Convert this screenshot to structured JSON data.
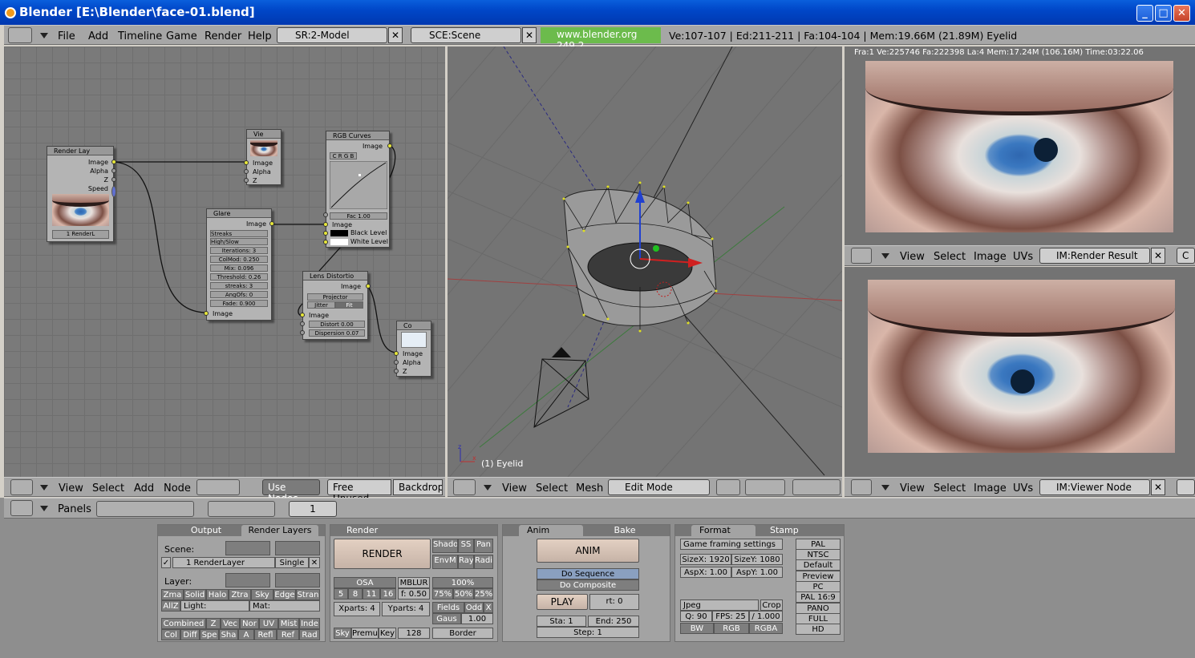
{
  "window": {
    "title": "Blender  [E:\\Blender\\face-01.blend]",
    "min": "_",
    "max": "□",
    "close": "✕"
  },
  "infobar": {
    "menus": [
      "File",
      "Add",
      "Timeline",
      "Game",
      "Render",
      "Help"
    ],
    "screen": "SR:2-Model",
    "scene": "SCE:Scene",
    "url": "www.blender.org 249.2",
    "stats": "Ve:107-107 | Ed:211-211 | Fa:104-104 | Mem:19.66M (21.89M) Eyelid"
  },
  "node_editor": {
    "menus": [
      "View",
      "Select",
      "Add",
      "Node"
    ],
    "use_nodes": "Use Nodes",
    "free_unused": "Free Unused",
    "backdrop": "Backdrop",
    "render_layers": {
      "title": "Render Lay",
      "outputs": [
        "Image",
        "Alpha",
        "Z",
        "Speed"
      ],
      "layer": "1 RenderL"
    },
    "viewer": {
      "title": "Vie",
      "inputs": [
        "Image",
        "Alpha",
        "Z"
      ]
    },
    "glare": {
      "title": "Glare",
      "output": "Image",
      "fields": [
        "Streaks",
        "High/Slow",
        "Iterations: 3",
        "ColMod: 0.250",
        "Mix: 0.096",
        "Threshold: 0.26",
        "streaks: 3",
        "AngOfs: 0",
        "Fade: 0.900"
      ],
      "input": "Image"
    },
    "rgb_curves": {
      "title": "RGB Curves",
      "output": "Image",
      "modes": "C R G B",
      "fac": "Fac 1.00",
      "inputs": [
        "Image",
        "Black Level",
        "White Level"
      ]
    },
    "lens": {
      "title": "Lens Distortio",
      "output": "Image",
      "projector": "Projector",
      "jitter": "Jitter",
      "fit": "Fit",
      "input": "Image",
      "fields": [
        "Distort 0.00",
        "Dispersion 0.07"
      ]
    },
    "composite": {
      "title": "Co",
      "inputs": [
        "Image",
        "Alpha",
        "Z"
      ]
    }
  },
  "viewport": {
    "menus": [
      "View",
      "Select",
      "Mesh"
    ],
    "mode": "Edit Mode",
    "object_label": "(1) Eyelid"
  },
  "image_top": {
    "info": "Fra:1  Ve:225746 Fa:222398 La:4 Mem:17.24M (106.16M) Time:03:22.06",
    "menus": [
      "View",
      "Select",
      "Image",
      "UVs"
    ],
    "image": "IM:Render Result"
  },
  "image_bottom": {
    "menus": [
      "View",
      "Select",
      "Image",
      "UVs"
    ],
    "image": "IM:Viewer Node"
  },
  "buttons": {
    "panels_label": "Panels",
    "frame": "1",
    "output_tab": "Output",
    "render_layers_tab": "Render Layers",
    "scene_label": "Scene:",
    "layer_label": "Layer:",
    "render_layer": "1 RenderLayer",
    "single": "Single",
    "passes1": [
      "Zma",
      "Solid",
      "Halo",
      "Ztra",
      "Sky",
      "Edge",
      "Stran"
    ],
    "allz": "AllZ",
    "light": "Light:",
    "mat": "Mat:",
    "passes2": [
      "Combined",
      "Z",
      "Vec",
      "Nor",
      "UV",
      "Mist",
      "Inde"
    ],
    "passes3": [
      "Col",
      "Diff",
      "Spe",
      "Sha",
      "A",
      "Refl",
      "Ref",
      "Rad"
    ],
    "render_tab": "Render",
    "render_btn": "RENDER",
    "shado": "Shado",
    "ss": "SS",
    "pan": "Pan",
    "envm": "EnvM",
    "ray": "Ray",
    "radi": "Radi",
    "osa": "OSA",
    "mblur": "MBLUR",
    "pct100": "100%",
    "osa_vals": [
      "5",
      "8",
      "11",
      "16"
    ],
    "fval": "f: 0.50",
    "pcts": [
      "75%",
      "50%",
      "25%"
    ],
    "xparts": "Xparts: 4",
    "yparts": "Yparts: 4",
    "fields": "Fields",
    "odd": "Odd",
    "x": "X",
    "gaus": "Gaus",
    "gausval": "1.00",
    "sky": "Sky",
    "premu": "Premu",
    "key": "Key",
    "bits": "128",
    "border": "Border",
    "anim_tab": "Anim",
    "bake_tab": "Bake",
    "anim_btn": "ANIM",
    "do_sequence": "Do Sequence",
    "do_composite": "Do Composite",
    "play": "PLAY",
    "rt": "rt: 0",
    "sta": "Sta: 1",
    "end": "End: 250",
    "step": "Step: 1",
    "format_tab": "Format",
    "stamp_tab": "Stamp",
    "game_framing": "Game framing settings",
    "sizex": "SizeX: 1920",
    "sizey": "SizeY: 1080",
    "aspx": "AspX: 1.00",
    "aspy": "AspY: 1.00",
    "presets": [
      "PAL",
      "NTSC",
      "Default",
      "Preview",
      "PC",
      "PAL 16:9",
      "PANO",
      "FULL",
      "HD"
    ],
    "jpeg": "Jpeg",
    "crop": "Crop",
    "q": "Q: 90",
    "fps": "FPS: 25",
    "fpsb": "/ 1.000",
    "bw": "BW",
    "rgb": "RGB",
    "rgba": "RGBA"
  }
}
